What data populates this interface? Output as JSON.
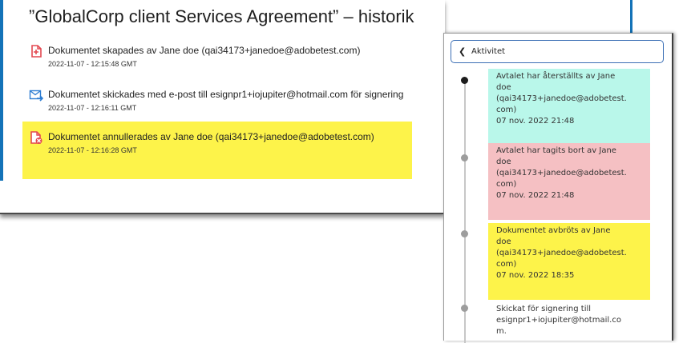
{
  "history": {
    "title": "”GlobalCorp client Services Agreement” – historik",
    "events": [
      {
        "icon": "document-created-icon",
        "text": "Dokumentet skapades av Jane doe (qai34173+janedoe@adobetest.com)",
        "time": "2022-11-07 - 12:15:48 GMT"
      },
      {
        "icon": "email-sent-icon",
        "text": "Dokumentet skickades med e-post till esignpr1+iojupiter@hotmail.com för signering",
        "time": "2022-11-07 - 12:16:11 GMT"
      },
      {
        "icon": "document-cancelled-icon",
        "text": "Dokumentet annullerades av Jane doe (qai34173+janedoe@adobetest.com)",
        "time": "2022-11-07 - 12:16:28 GMT",
        "highlight": "#fdf34a"
      }
    ]
  },
  "activity": {
    "back_label": "Aktivitet",
    "items": [
      {
        "lines": [
          "Avtalet har återställts av Jane",
          "doe",
          "(qai34173+janedoe@adobetest.",
          "com)"
        ],
        "time": "07 nov. 2022 21:48",
        "color": "#b9f7ea"
      },
      {
        "lines": [
          "Avtalet har tagits bort av Jane",
          "doe",
          "(qai34173+janedoe@adobetest.",
          "com)"
        ],
        "time": "07 nov. 2022 21:48",
        "color": "#f5c0c3"
      },
      {
        "lines": [
          "Dokumentet avbröts av Jane",
          "doe",
          "(qai34173+janedoe@adobetest.",
          "com)"
        ],
        "time": "07 nov. 2022 18:35",
        "color": "#fdf34a"
      },
      {
        "lines": [
          "Skickat för signering till",
          "esignpr1+iojupiter@hotmail.co",
          "m."
        ],
        "time": ""
      }
    ]
  },
  "colors": {
    "accent": "#1473b8",
    "highlight_yellow": "#fdf34a",
    "highlight_cyan": "#b9f7ea",
    "highlight_pink": "#f5c0c3",
    "adobe_red": "#e34850"
  }
}
